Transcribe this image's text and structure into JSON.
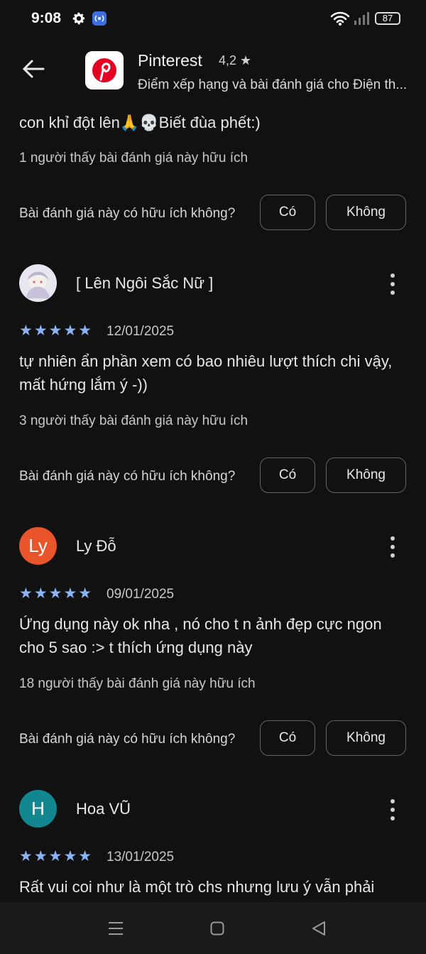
{
  "status": {
    "time": "9:08",
    "battery": "87",
    "icons": [
      "gear-icon",
      "cast-icon",
      "wifi-icon",
      "signal-icon",
      "battery-icon"
    ]
  },
  "header": {
    "app_name": "Pinterest",
    "rating": "4,2",
    "subtitle": "Điểm xếp hạng và bài đánh giá cho Điện th..."
  },
  "prev_review": {
    "text": "con khỉ đột lên🙏💀Biết đùa phết:)",
    "helpful": "1 người thấy bài đánh giá này hữu ích"
  },
  "ask_label": "Bài đánh giá này có hữu ích không?",
  "yes_label": "Có",
  "no_label": "Không",
  "reviews": [
    {
      "name": "[ Lên Ngôi Sắc Nữ ]",
      "avatar": "",
      "date": "12/01/2025",
      "stars": 5,
      "text": "tự nhiên ẩn phần xem có bao nhiêu lượt thích chi vậy, mất hứng lắm ý -))",
      "helpful": "3 người thấy bài đánh giá này hữu ích"
    },
    {
      "name": "Ly Đỗ",
      "avatar": "Ly",
      "date": "09/01/2025",
      "stars": 5,
      "text": "Ứng dụng này ok nha , nó cho t n ảnh đẹp cực ngon cho 5 sao :> t thích ứng dụng này",
      "helpful": "18 người thấy bài đánh giá này hữu ích"
    },
    {
      "name": "Hoa VŨ",
      "avatar": "H",
      "date": "13/01/2025",
      "stars": 5,
      "text": "Rất vui coi như là một trò chs nhưng lưu ý vẫn phải",
      "helpful": ""
    }
  ],
  "colors": {
    "accent_star": "#8ab4f8",
    "ly_avatar": "#e8552b",
    "h_avatar": "#13878f",
    "background": "#111111"
  }
}
